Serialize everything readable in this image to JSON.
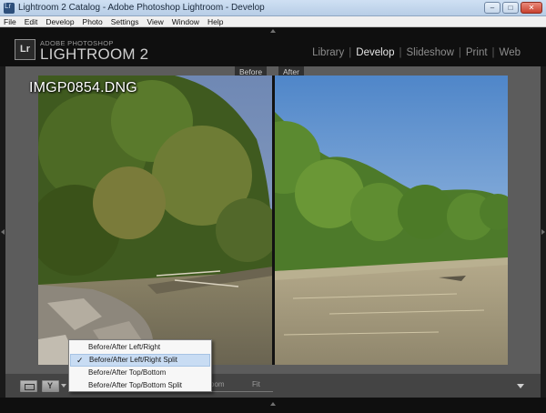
{
  "window": {
    "title": "Lightroom 2 Catalog - Adobe Photoshop Lightroom - Develop",
    "controls": [
      "–",
      "□",
      "✕"
    ]
  },
  "menubar": {
    "items": [
      "File",
      "Edit",
      "Develop",
      "Photo",
      "Settings",
      "View",
      "Window",
      "Help"
    ]
  },
  "identity": {
    "logo": "Lr",
    "brand_small": "ADOBE PHOTOSHOP",
    "brand_big": "LIGHTROOM 2"
  },
  "modules": {
    "items": [
      "Library",
      "Develop",
      "Slideshow",
      "Print",
      "Web"
    ],
    "active": "Develop"
  },
  "view": {
    "before_label": "Before",
    "after_label": "After",
    "filename": "IMGP0854.DNG"
  },
  "toolbar": {
    "zoom_label": "oom",
    "fit_label": "Fit"
  },
  "popup_menu": {
    "items": [
      "Before/After Left/Right",
      "Before/After Left/Right Split",
      "Before/After Top/Bottom",
      "Before/After Top/Bottom Split"
    ],
    "checked_index": 1
  },
  "colors": {
    "panel_bg": "#5c5c5c",
    "selection": "#c8dcf3"
  }
}
